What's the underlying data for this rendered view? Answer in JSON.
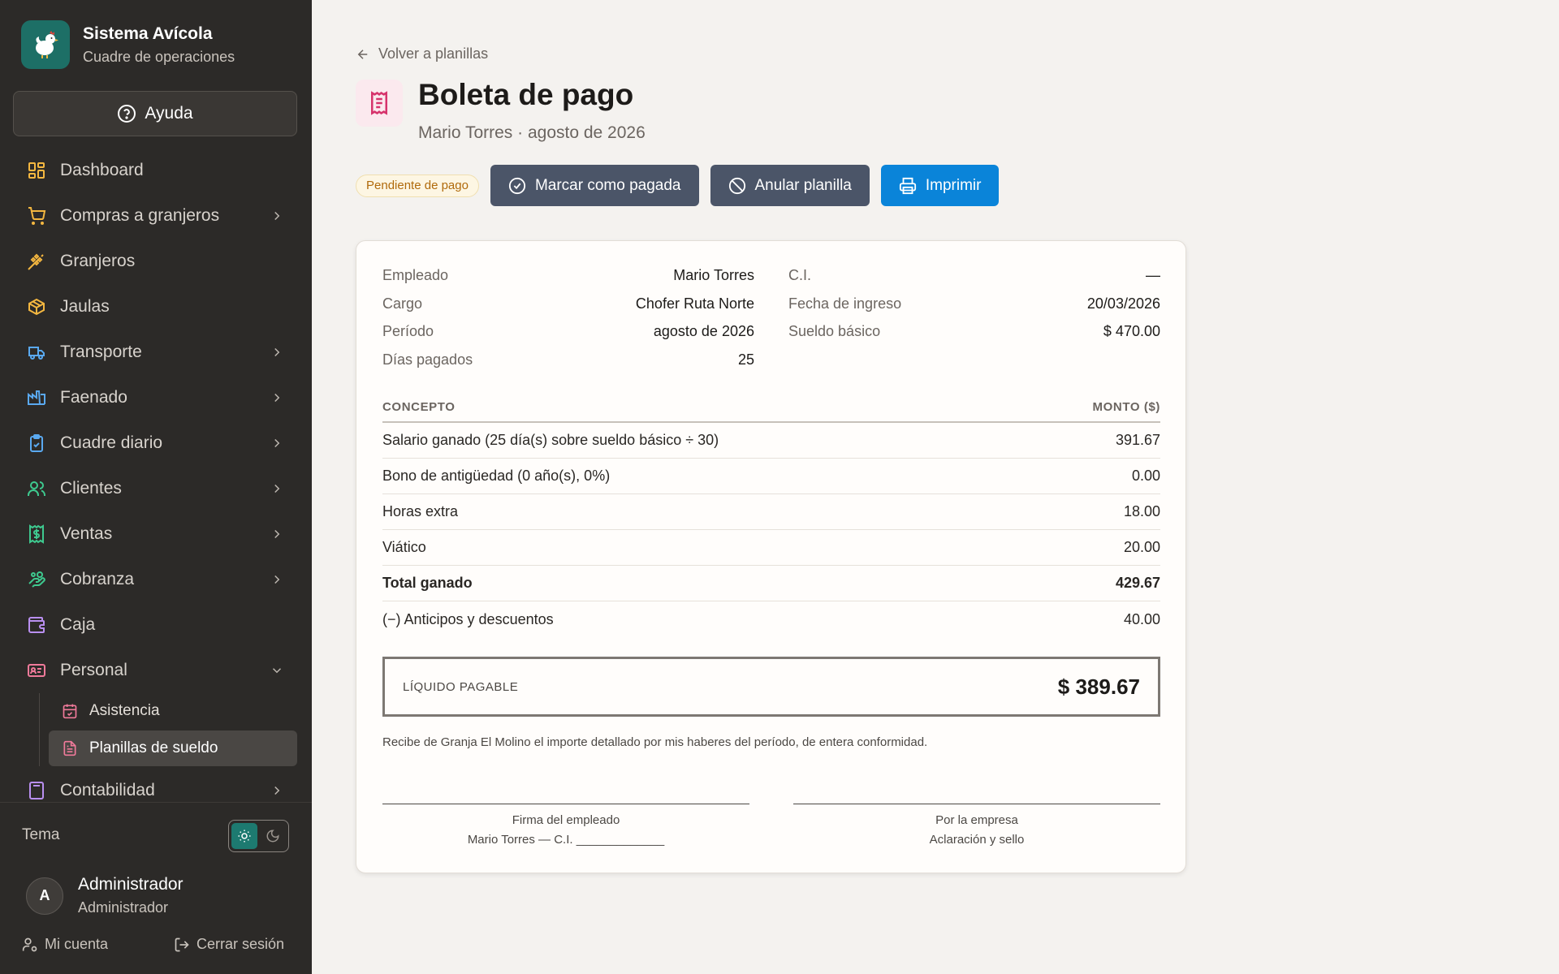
{
  "brand": {
    "title": "Sistema Avícola",
    "subtitle": "Cuadre de operaciones"
  },
  "help_label": "Ayuda",
  "nav": {
    "items": [
      {
        "label": "Dashboard",
        "icon": "dashboard-icon",
        "color": "#f4b740"
      },
      {
        "label": "Compras a granjeros",
        "icon": "cart-icon",
        "color": "#f4b740"
      },
      {
        "label": "Granjeros",
        "icon": "wheat-icon",
        "color": "#f4b740"
      },
      {
        "label": "Jaulas",
        "icon": "box-icon",
        "color": "#f4b740"
      },
      {
        "label": "Transporte",
        "icon": "truck-icon",
        "color": "#5aa9f0"
      },
      {
        "label": "Faenado",
        "icon": "factory-icon",
        "color": "#5aa9f0"
      },
      {
        "label": "Cuadre diario",
        "icon": "clipboard-icon",
        "color": "#5aa9f0"
      },
      {
        "label": "Clientes",
        "icon": "users-icon",
        "color": "#3ec98f"
      },
      {
        "label": "Ventas",
        "icon": "receipt-dollar-icon",
        "color": "#3ec98f"
      },
      {
        "label": "Cobranza",
        "icon": "hand-coins-icon",
        "color": "#3ec98f"
      },
      {
        "label": "Caja",
        "icon": "wallet-icon",
        "color": "#b98ff0"
      },
      {
        "label": "Personal",
        "icon": "id-card-icon",
        "color": "#f07a9a"
      },
      {
        "label": "Contabilidad",
        "icon": "calculator-icon",
        "color": "#b98ff0"
      }
    ],
    "personal_sub": [
      {
        "label": "Asistencia",
        "icon": "calendar-check-icon"
      },
      {
        "label": "Planillas de sueldo",
        "icon": "file-text-icon"
      }
    ]
  },
  "theme": {
    "label": "Tema",
    "selected": "light"
  },
  "user": {
    "initial": "A",
    "name": "Administrador",
    "role": "Administrador"
  },
  "account": {
    "mi_cuenta": "Mi cuenta",
    "cerrar_sesion": "Cerrar sesión"
  },
  "header": {
    "back_label": "Volver a planillas",
    "title": "Boleta de pago",
    "subtitle": "Mario Torres · agosto de 2026"
  },
  "status_badge": "Pendiente de pago",
  "buttons": {
    "mark_paid": "Marcar como pagada",
    "annul": "Anular planilla",
    "print": "Imprimir"
  },
  "colors": {
    "accent": "#0a84d9",
    "sidebar": "#2c2a28",
    "dark_button": "#4b5568",
    "pending": "#b06a0b"
  },
  "slip": {
    "left_info": [
      {
        "label": "Empleado",
        "value": "Mario Torres"
      },
      {
        "label": "Cargo",
        "value": "Chofer Ruta Norte"
      },
      {
        "label": "Período",
        "value": "agosto de 2026"
      },
      {
        "label": "Días pagados",
        "value": "25"
      }
    ],
    "right_info": [
      {
        "label": "C.I.",
        "value": "—"
      },
      {
        "label": "Fecha de ingreso",
        "value": "20/03/2026"
      },
      {
        "label": "Sueldo básico",
        "value": "$ 470.00"
      }
    ],
    "table_headers": {
      "concept": "CONCEPTO",
      "amount": "MONTO ($)"
    },
    "rows": [
      {
        "concept": "Salario ganado (25 día(s) sobre sueldo básico ÷ 30)",
        "amount": "391.67"
      },
      {
        "concept": "Bono de antigüedad (0 año(s), 0%)",
        "amount": "0.00"
      },
      {
        "concept": "Horas extra",
        "amount": "18.00"
      },
      {
        "concept": "Viático",
        "amount": "20.00"
      },
      {
        "concept": "Total ganado",
        "amount": "429.67"
      },
      {
        "concept": "(−) Anticipos y descuentos",
        "amount": "40.00"
      }
    ],
    "net_label": "LÍQUIDO PAGABLE",
    "net_value": "$ 389.67",
    "receipt_text": "Recibe de Granja El Molino el importe detallado por mis haberes del período, de entera conformidad.",
    "signature_employee": {
      "line1": "Firma del empleado",
      "line2": "Mario Torres — C.I. _____________"
    },
    "signature_company": {
      "line1": "Por la empresa",
      "line2": "Aclaración y sello"
    }
  }
}
